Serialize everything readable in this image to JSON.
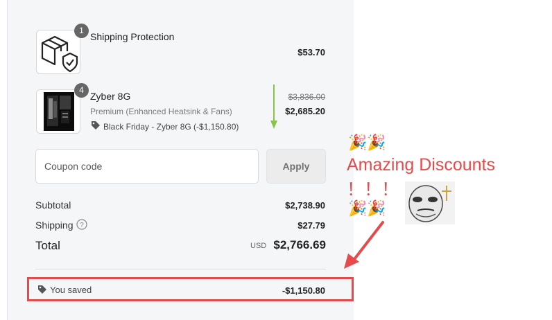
{
  "items": [
    {
      "quantity": "1",
      "name": "Shipping Protection",
      "price": "$53.70",
      "icon": "package-shield-icon"
    },
    {
      "quantity": "4",
      "name": "Zyber 8G",
      "variant": "Premium (Enhanced Heatsink & Fans)",
      "discount_label": "Black Friday - Zyber 8G (-$1,150.80)",
      "original_price": "$3,836.00",
      "price": "$2,685.20",
      "image": "pc-case-image"
    }
  ],
  "coupon": {
    "placeholder": "Coupon code",
    "apply_label": "Apply"
  },
  "totals": {
    "subtotal_label": "Subtotal",
    "subtotal": "$2,738.90",
    "shipping_label": "Shipping",
    "shipping": "$27.79",
    "total_label": "Total",
    "currency": "USD",
    "total": "$2,766.69",
    "saved_label": "You saved",
    "saved": "-$1,150.80"
  },
  "annotation": {
    "title": "Amazing Discounts",
    "exclaim": "！！！",
    "popper": "🎉🎉"
  },
  "colors": {
    "highlight_red": "#e24b4b",
    "arrow_green": "#8bc34a"
  }
}
